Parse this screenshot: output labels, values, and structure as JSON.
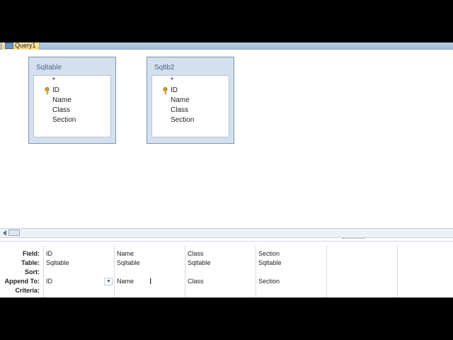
{
  "tab": {
    "label": "Query1"
  },
  "tables": [
    {
      "title": "Sqltable",
      "star": "*",
      "fields": [
        "ID",
        "Name",
        "Class",
        "Section"
      ]
    },
    {
      "title": "Sqltb2",
      "star": "*",
      "fields": [
        "ID",
        "Name",
        "Class",
        "Section"
      ]
    }
  ],
  "grid": {
    "row_labels": {
      "field": "Field:",
      "table": "Table:",
      "sort": "Sort:",
      "append_to": "Append To:",
      "criteria": "Criteria:"
    },
    "columns": [
      {
        "field": "ID",
        "table": "Sqltable",
        "append_to": "ID"
      },
      {
        "field": "Name",
        "table": "Sqltable",
        "append_to": "Name"
      },
      {
        "field": "Class",
        "table": "Sqltable",
        "append_to": "Class"
      },
      {
        "field": "Section",
        "table": "Sqltable",
        "append_to": "Section"
      }
    ]
  },
  "icons": {
    "primary_key": "key-icon",
    "dropdown": "chevron-down-icon",
    "cursor": "i-beam-cursor-icon"
  },
  "colors": {
    "tab_active": "#f6d67a",
    "title_bar": "#a5bdd9",
    "table_frame": "#d5e0ee"
  }
}
